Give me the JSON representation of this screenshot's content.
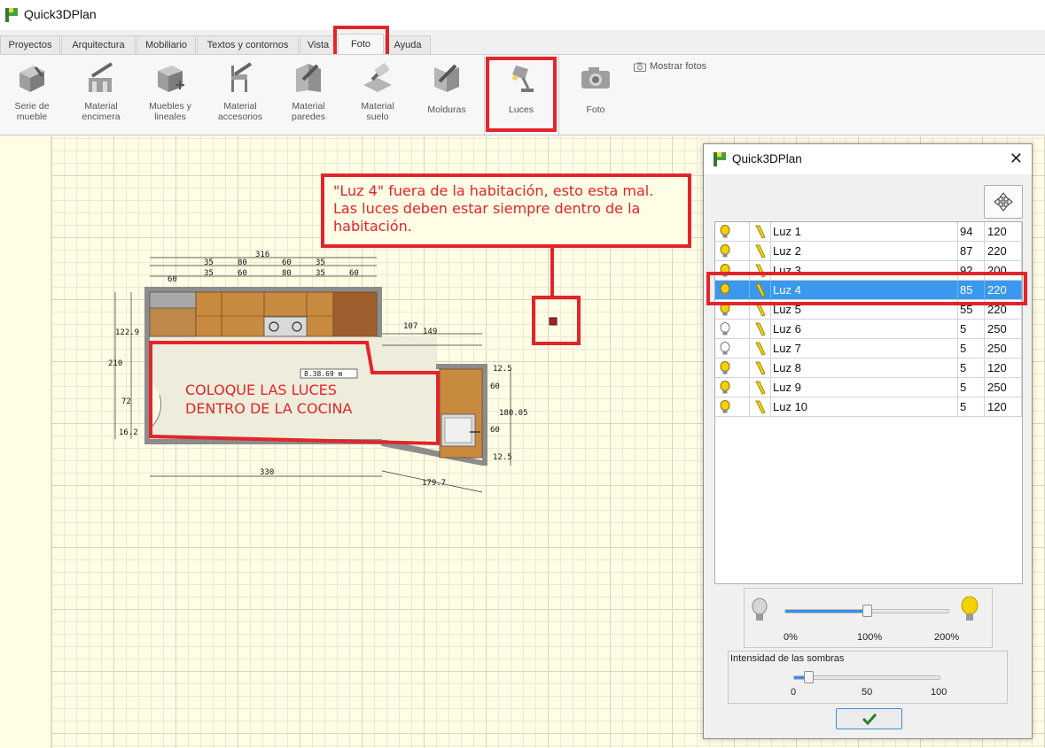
{
  "app": {
    "title": "Quick3DPlan"
  },
  "tabs": [
    {
      "label": "Proyectos"
    },
    {
      "label": "Arquitectura"
    },
    {
      "label": "Mobiliario"
    },
    {
      "label": "Textos y contornos"
    },
    {
      "label": "Vista"
    },
    {
      "label": "Foto",
      "active": true
    },
    {
      "label": "Ayuda"
    }
  ],
  "toolbar": {
    "tools": [
      {
        "label": "Serie de\nmueble",
        "icon": "furniture-series-icon"
      },
      {
        "label": "Material\nencimera",
        "icon": "countertop-material-icon"
      },
      {
        "label": "Muebles y\nlineales",
        "icon": "linear-furniture-icon"
      },
      {
        "label": "Material\naccesorios",
        "icon": "accessories-material-icon"
      },
      {
        "label": "Material\nparedes",
        "icon": "wall-material-icon"
      },
      {
        "label": "Material\nsuelo",
        "icon": "floor-material-icon"
      },
      {
        "label": "Molduras",
        "icon": "mouldings-icon"
      },
      {
        "label": "Luces",
        "icon": "lamp-icon"
      },
      {
        "label": "Foto",
        "icon": "camera-icon"
      }
    ],
    "show_photos": "Mostrar fotos"
  },
  "plan": {
    "dims": {
      "top_total": "316",
      "top_row1": [
        "35",
        "80",
        "60",
        "35"
      ],
      "top_row2": [
        "60",
        "35",
        "60",
        "80",
        "35",
        "60"
      ],
      "left_height": "210",
      "left_upper": "122.9",
      "left_door": "72",
      "left_lower": "16.2",
      "right_107": "107",
      "right_149": "149",
      "bottom_330": "330",
      "bottom_diag": "179.7",
      "right_side": [
        "12.5",
        "60",
        "60",
        "12.5"
      ],
      "right_total": "180.05",
      "area_label": "8.38.69 m"
    }
  },
  "annotations": {
    "callout": "\"Luz 4\" fuera de la habitación, esto esta mal. Las luces deben estar siempre dentro de la habitación.",
    "kitchen_note": "COLOQUE LAS LUCES DENTRO DE LA COCINA"
  },
  "dialog": {
    "title": "Quick3DPlan",
    "lights": [
      {
        "name": "Luz 1",
        "v1": "94",
        "v2": "120",
        "on": true
      },
      {
        "name": "Luz 2",
        "v1": "87",
        "v2": "220",
        "on": true
      },
      {
        "name": "Luz 3",
        "v1": "92",
        "v2": "200",
        "on": true
      },
      {
        "name": "Luz 4",
        "v1": "85",
        "v2": "220",
        "on": true,
        "selected": true
      },
      {
        "name": "Luz 5",
        "v1": "55",
        "v2": "220",
        "on": true
      },
      {
        "name": "Luz 6",
        "v1": "5",
        "v2": "250",
        "on": false
      },
      {
        "name": "Luz 7",
        "v1": "5",
        "v2": "250",
        "on": false
      },
      {
        "name": "Luz 8",
        "v1": "5",
        "v2": "120",
        "on": true
      },
      {
        "name": "Luz 9",
        "v1": "5",
        "v2": "250",
        "on": true
      },
      {
        "name": "Luz 10",
        "v1": "5",
        "v2": "120",
        "on": true
      }
    ],
    "intensity": {
      "min": "0%",
      "mid": "100%",
      "max": "200%",
      "value_percent": 100
    },
    "shadows": {
      "title": "Intensidad de las sombras",
      "min": "0",
      "mid": "50",
      "max": "100",
      "value": 10
    }
  },
  "colors": {
    "accent": "#3a99ee",
    "annotation": "#e3242b",
    "grid_bg": "#fffde5",
    "wood": "#c78a3e"
  }
}
